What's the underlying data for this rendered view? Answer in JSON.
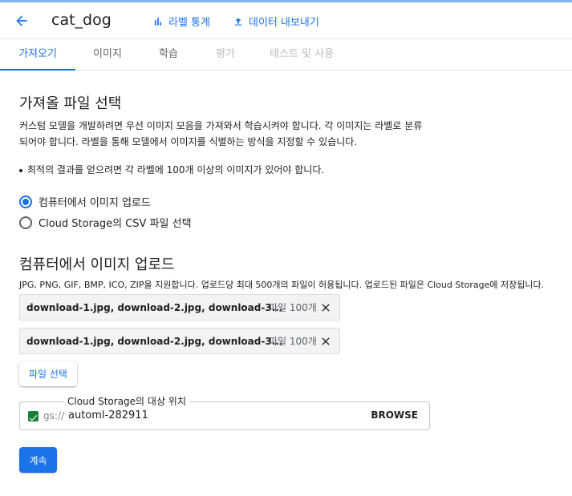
{
  "header": {
    "title": "cat_dog",
    "label_stats": "라벨 통계",
    "export_data": "데이터 내보내기",
    "accent_color": "#1a73e8"
  },
  "tabs": [
    {
      "label": "가져오기",
      "state": "active"
    },
    {
      "label": "이미지",
      "state": "normal"
    },
    {
      "label": "학습",
      "state": "normal"
    },
    {
      "label": "평가",
      "state": "disabled"
    },
    {
      "label": "테스트 및 사용",
      "state": "disabled"
    }
  ],
  "import": {
    "heading": "가져올 파일 선택",
    "desc_line1": "커스텀 모델을 개발하려면 우선 이미지 모음을 가져와서 학습시켜야 합니다. 각 이미지는 라벨로 분류",
    "desc_line2": "되어야 합니다. 라벨을 통해 모델에서 이미지를 식별하는 방식을 지정할 수 있습니다.",
    "bullet": "최적의 결과를 얻으려면 각 라벨에 100개 이상의 이미지가 있어야 합니다.",
    "options": [
      {
        "label": "컴퓨터에서 이미지 업로드",
        "checked": true
      },
      {
        "label": "Cloud Storage의 CSV 파일 선택",
        "checked": false
      }
    ]
  },
  "upload": {
    "heading": "컴퓨터에서 이미지 업로드",
    "note": "JPG, PNG, GIF, BMP, ICO, ZIP을 지원합니다. 업로드당 최대 500개의 파일이 허용됩니다. 업로드된 파일은 Cloud Storage에 저장됩니다.",
    "files": [
      {
        "names": "download-1.jpg, download-2.jpg, download-3...",
        "count": "파일 100개"
      },
      {
        "names": "download-1.jpg, download-2.jpg, download-3...",
        "count": "파일 100개"
      }
    ],
    "select_button": "파일 선택",
    "destination_label": "Cloud Storage의 대상 위치",
    "destination_prefix": "gs://",
    "destination_value": "automl-282911",
    "browse": "BROWSE",
    "continue_button": "계속"
  }
}
